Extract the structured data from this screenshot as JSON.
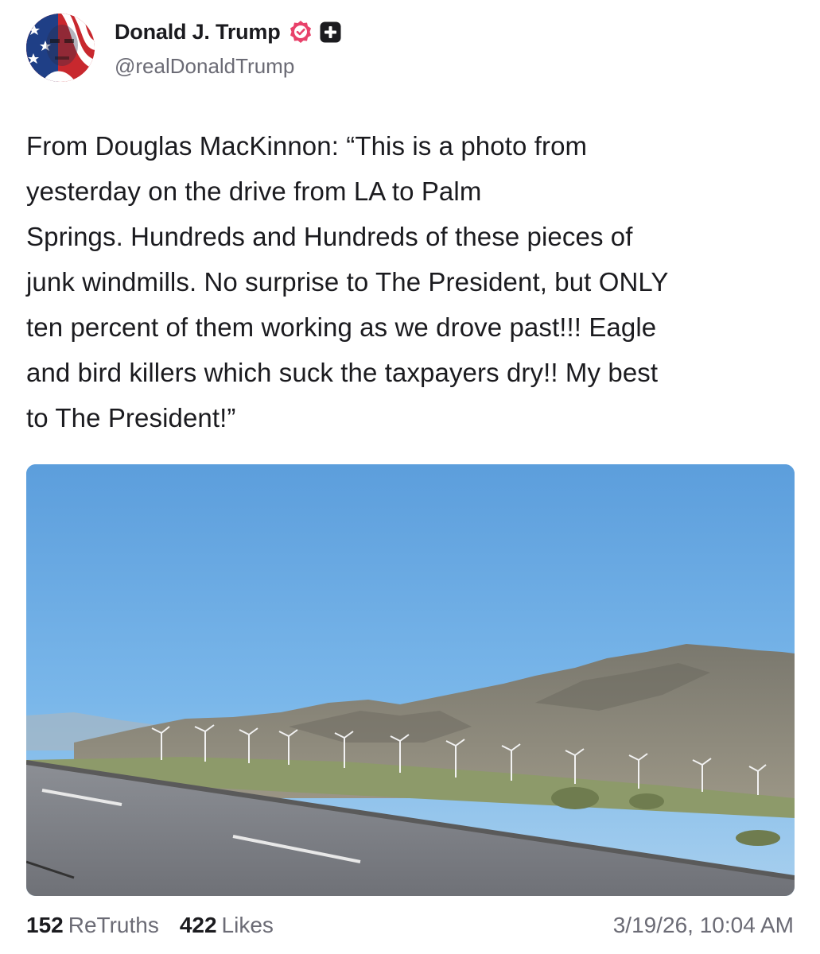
{
  "post": {
    "author": {
      "display_name": "Donald J. Trump",
      "handle": "@realDonaldTrump",
      "avatar_icon": "flag-face-avatar",
      "verified_icon": "verified-badge-icon",
      "badge_icon": "truth-plus-icon"
    },
    "text": "From Douglas MacKinnon: “This is a photo from\nyesterday on the drive from LA to Palm\nSprings. Hundreds and Hundreds of these pieces of\njunk windmills. No surprise to The President, but ONLY\nten percent of them working as we drove past!!! Eagle\nand bird killers which suck the taxpayers dry!! My best\nto The President!”",
    "media": {
      "type": "photo",
      "subject": "desert highway with wind turbines and mountains"
    },
    "stats": {
      "retruths_count": "152",
      "retruths_label": "ReTruths",
      "likes_count": "422",
      "likes_label": "Likes"
    },
    "timestamp": "3/19/26, 10:04 AM"
  },
  "colors": {
    "verified_badge": "#e8416a",
    "text_primary": "#1b1b1f",
    "text_secondary": "#6b6b75"
  }
}
